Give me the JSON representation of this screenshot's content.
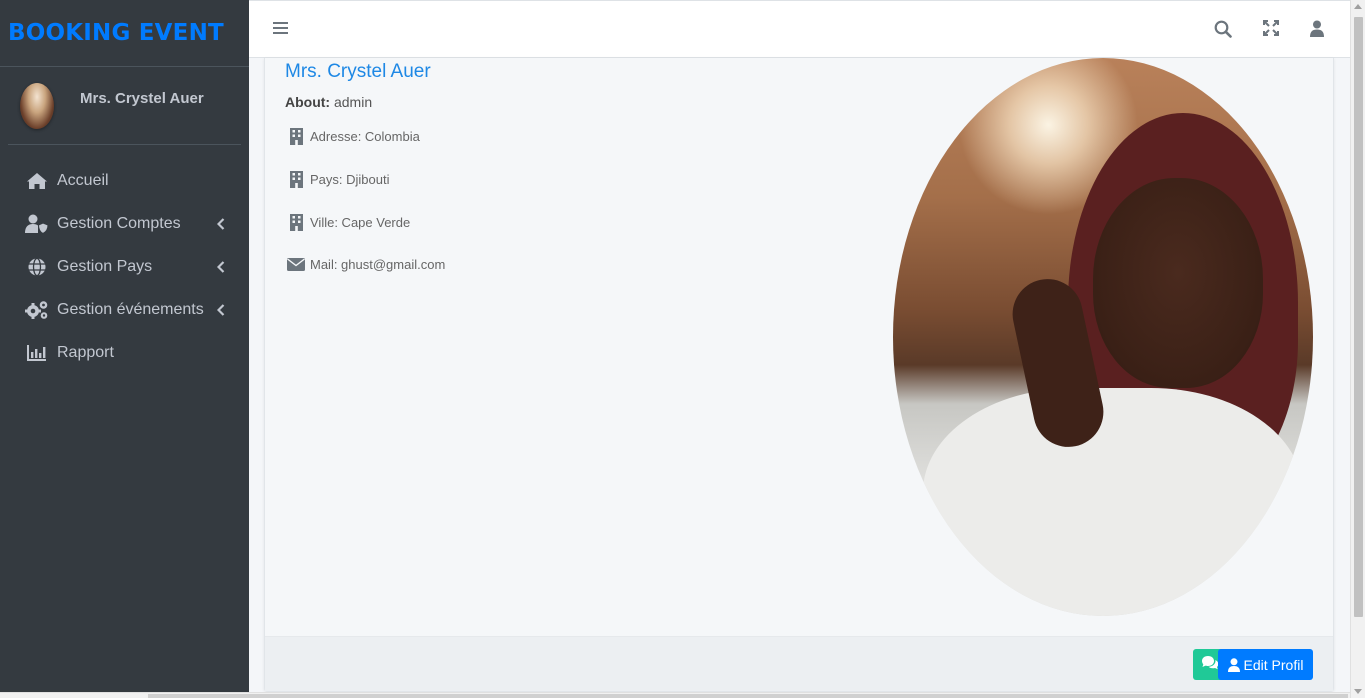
{
  "brand": {
    "title": "BOOKING EVENT"
  },
  "user_panel": {
    "name": "Mrs. Crystel Auer"
  },
  "sidebar": {
    "items": [
      {
        "label": "Accueil",
        "icon": "home-icon",
        "has_submenu": false
      },
      {
        "label": "Gestion Comptes",
        "icon": "user-shield-icon",
        "has_submenu": true
      },
      {
        "label": "Gestion Pays",
        "icon": "globe-icon",
        "has_submenu": true
      },
      {
        "label": "Gestion événements",
        "icon": "cogs-icon",
        "has_submenu": true
      },
      {
        "label": "Rapport",
        "icon": "chart-bar-icon",
        "has_submenu": false
      }
    ]
  },
  "topbar": {
    "icons": [
      "hamburger-icon",
      "search-icon",
      "expand-icon",
      "user-icon"
    ]
  },
  "profile": {
    "name": "Mrs. Crystel Auer",
    "about_label": "About:",
    "about_value": "admin",
    "address": "Adresse: Colombia",
    "country": "Pays: Djibouti",
    "city": "Ville: Cape Verde",
    "mail": "Mail: ghust@gmail.com"
  },
  "footer": {
    "edit_label": "Edit Profil"
  },
  "colors": {
    "sidebar_bg": "#343a40",
    "brand": "#007bff",
    "accent_blue": "#007bff",
    "chat_green": "#20c997",
    "name_blue": "#1e88e5"
  }
}
